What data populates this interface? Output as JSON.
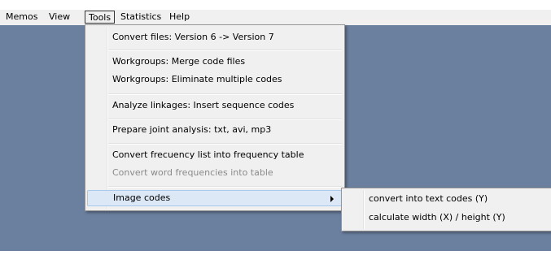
{
  "menubar": {
    "items": [
      {
        "label": "Memos"
      },
      {
        "label": "View"
      },
      {
        "label": "Tools"
      },
      {
        "label": "Statistics"
      },
      {
        "label": "Help"
      }
    ]
  },
  "tools_menu": {
    "items": [
      {
        "label": "Convert files: Version 6 -> Version 7"
      },
      {
        "label": "Workgroups: Merge code files"
      },
      {
        "label": "Workgroups: Eliminate multiple codes"
      },
      {
        "label": "Analyze linkages: Insert sequence codes"
      },
      {
        "label": "Prepare joint analysis: txt, avi, mp3"
      },
      {
        "label": "Convert frecuency list into frequency table"
      },
      {
        "label": "Convert word frequencies into table",
        "disabled": true
      },
      {
        "label": "Image codes",
        "has_submenu": true
      }
    ]
  },
  "image_codes_submenu": {
    "items": [
      {
        "label": "convert into text codes (Y)"
      },
      {
        "label": "calculate width (X) / height (Y)"
      }
    ]
  },
  "colors": {
    "workspace_background": "#6b7f9e",
    "menu_background": "#f0f0f0",
    "highlight": "#dce8f6"
  }
}
